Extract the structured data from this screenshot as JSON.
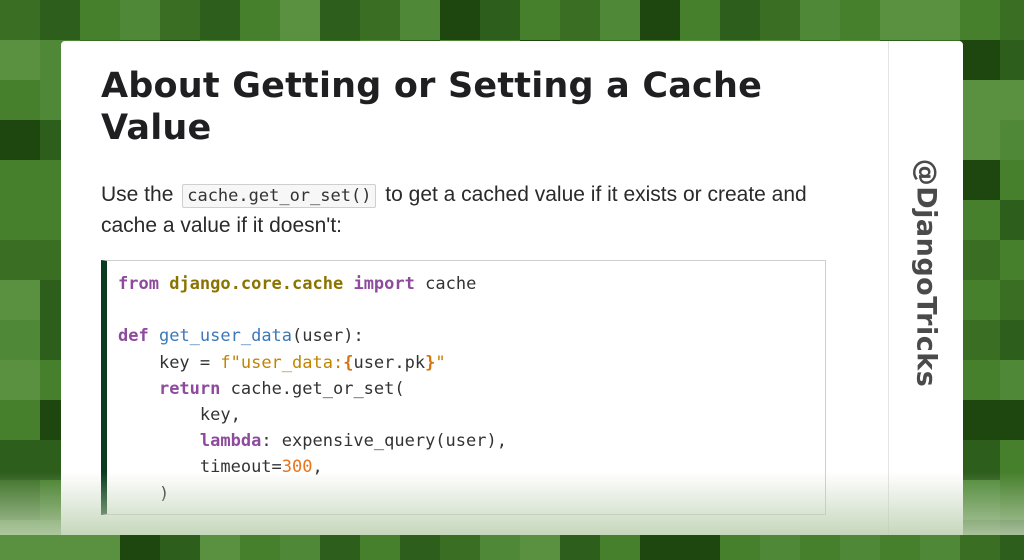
{
  "colors": {
    "bg_shades": [
      "#46802c",
      "#4f8938",
      "#3a6f23",
      "#2d5e1c",
      "#1d470f",
      "#5a9140"
    ],
    "code_accent": "#0b3b1e"
  },
  "card": {
    "title": "About Getting or Setting a Cache Value",
    "intro_before": "Use the",
    "intro_code": "cache.get_or_set()",
    "intro_after": "to get a cached value if it exists or create and cache a value if it doesn't:",
    "handle": "@DjangoTricks"
  },
  "code": {
    "l1": {
      "kw_from": "from",
      "module": "django.core.cache",
      "kw_import": "import",
      "name": "cache"
    },
    "l3": {
      "kw_def": "def",
      "fn": "get_user_data",
      "params": "(user):"
    },
    "l4": {
      "lhs": "key = ",
      "str_prefix": "f\"user_data:",
      "brace_open": "{",
      "expr": "user.pk",
      "brace_close": "}",
      "str_suffix": "\""
    },
    "l5": {
      "kw_return": "return",
      "call": "cache.get_or_set("
    },
    "l6": {
      "text": "key,"
    },
    "l7": {
      "kw_lambda": "lambda",
      "rest": ": expensive_query(user),"
    },
    "l8": {
      "name": "timeout=",
      "num": "300",
      "comma": ","
    },
    "l9": {
      "text": ")"
    }
  }
}
